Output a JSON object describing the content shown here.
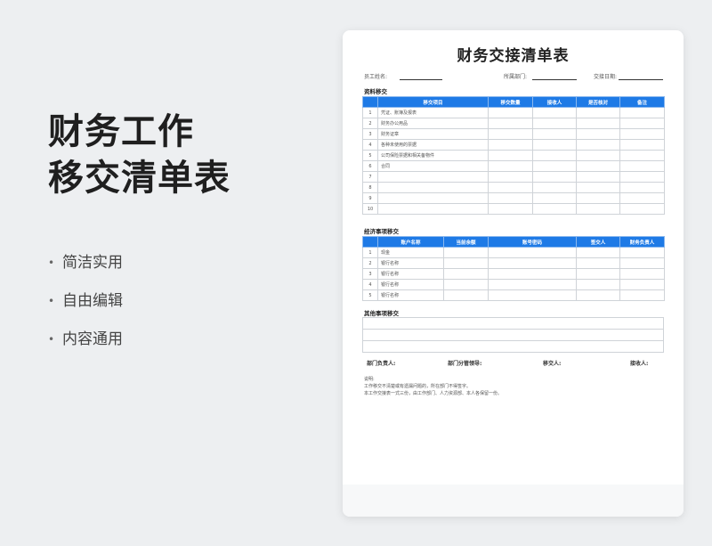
{
  "hero": {
    "title_line1": "财务工作",
    "title_line2": "移交清单表",
    "bullets": [
      "简洁实用",
      "自由编辑",
      "内容通用"
    ]
  },
  "doc": {
    "title": "财务交接清单表",
    "meta": {
      "employee_label": "员工姓名:",
      "dept_label": "所属部门:",
      "date_label": "交接日期:"
    },
    "materials": {
      "title": "资料移交",
      "headers": [
        "移交项目",
        "移交数量",
        "接收人",
        "是否核对",
        "备注"
      ],
      "rows": [
        {
          "no": "1",
          "item": "凭证、账簿及报表"
        },
        {
          "no": "2",
          "item": "财务办公用品"
        },
        {
          "no": "3",
          "item": "财务证章"
        },
        {
          "no": "4",
          "item": "各种未使用的票据"
        },
        {
          "no": "5",
          "item": "公司保险票据和相关备物件"
        },
        {
          "no": "6",
          "item": "合同"
        },
        {
          "no": "7",
          "item": ""
        },
        {
          "no": "8",
          "item": ""
        },
        {
          "no": "9",
          "item": ""
        },
        {
          "no": "10",
          "item": ""
        }
      ]
    },
    "economic": {
      "title": "经济事项移交",
      "headers": [
        "账户名称",
        "当前余额",
        "账号密码",
        "签交人",
        "财务负责人"
      ],
      "rows": [
        {
          "no": "1",
          "item": "现金"
        },
        {
          "no": "2",
          "item": "银行名称"
        },
        {
          "no": "3",
          "item": "银行名称"
        },
        {
          "no": "4",
          "item": "银行名称"
        },
        {
          "no": "5",
          "item": "银行名称"
        }
      ]
    },
    "other": {
      "title": "其他事项移交"
    },
    "signatures": [
      "部门负责人:",
      "部门分管领导:",
      "移交人:",
      "接收人:"
    ],
    "notes": [
      "说明:",
      "工作移交不清楚或有遗漏问题的，所在部门不得签字。",
      "本工作交接表一式三份，由工作部门、人力资源部、本人各保留一份。"
    ]
  }
}
